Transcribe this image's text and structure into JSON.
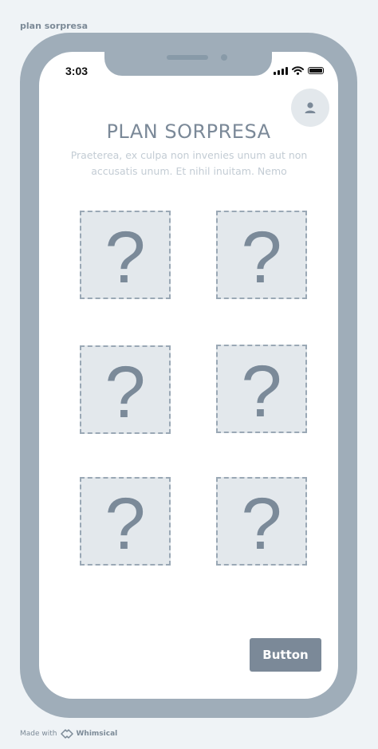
{
  "frame": {
    "title": "plan sorpresa"
  },
  "status_bar": {
    "time": "3:03"
  },
  "header": {
    "title": "PLAN SORPRESA",
    "subtitle": "Praeterea, ex culpa non invenies unum aut non accusatis unum. Et nihil inuitam. Nemo"
  },
  "icons": {
    "profile": "user-icon",
    "signal": "signal-icon",
    "wifi": "wifi-icon",
    "battery": "battery-icon",
    "logo": "whimsical-logo-icon"
  },
  "cards": [
    {
      "symbol": "?"
    },
    {
      "symbol": "?"
    },
    {
      "symbol": "?"
    },
    {
      "symbol": "?"
    },
    {
      "symbol": "?"
    },
    {
      "symbol": "?"
    }
  ],
  "actions": {
    "primary_label": "Button"
  },
  "footer": {
    "made_with": "Made with",
    "brand": "Whimsical"
  },
  "colors": {
    "device": "#9fadb9",
    "accent": "#7b8998",
    "card_bg": "#e3e8ec",
    "background": "#eff3f6"
  }
}
